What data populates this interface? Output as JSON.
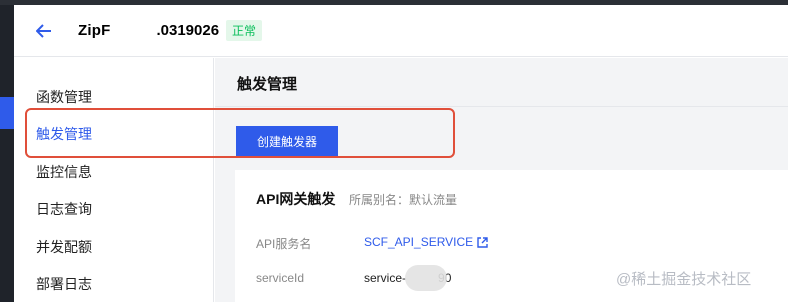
{
  "header": {
    "function_name": "ZipF",
    "function_id_suffix": ".0319026",
    "status": "正常"
  },
  "sidebar": {
    "items": [
      {
        "label": "函数管理"
      },
      {
        "label": "触发管理"
      },
      {
        "label": "监控信息"
      },
      {
        "label": "日志查询"
      },
      {
        "label": "并发配额"
      },
      {
        "label": "部署日志"
      }
    ],
    "active_index": 1
  },
  "main": {
    "title": "触发管理",
    "create_button_label": "创建触发器",
    "card": {
      "title": "API网关触发",
      "alias_label": "所属别名：默认流量",
      "rows": [
        {
          "label": "API服务名",
          "value": "SCF_API_SERVICE"
        },
        {
          "label": "serviceId",
          "value_prefix": "service-",
          "value_suffix": "90"
        }
      ]
    }
  },
  "watermark": "@稀土掘金技术社区",
  "colors": {
    "accent": "#2f5bea",
    "status_green": "#0abf5b",
    "highlight_red": "#e04f3a"
  }
}
